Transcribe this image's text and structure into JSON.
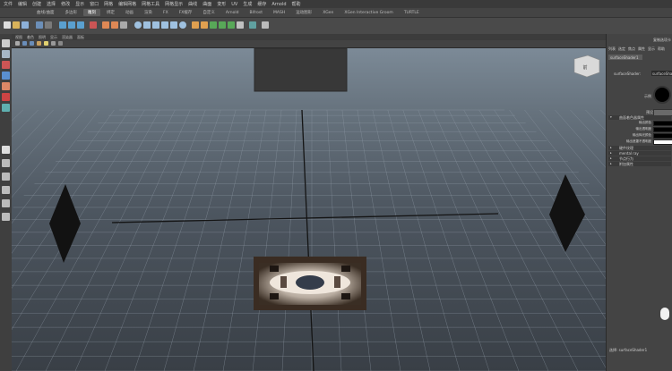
{
  "menubar": {
    "items": [
      "文件",
      "编辑",
      "创建",
      "选择",
      "修改",
      "显示",
      "窗口",
      "网格",
      "编辑网格",
      "网格工具",
      "网格显示",
      "曲线",
      "曲面",
      "变形",
      "UV",
      "生成",
      "缓存",
      "Arnold",
      "帮助"
    ]
  },
  "shelf_tabs": {
    "items": [
      "曲线/曲面",
      "多边形",
      "雕刻",
      "绑定",
      "动画",
      "渲染",
      "FX",
      "FX缓存",
      "自定义",
      "Arnold",
      "Bifrost",
      "MASH",
      "运动图形",
      "XGen",
      "XGen Interactive Groom",
      "TURTLE"
    ],
    "active_index": 2
  },
  "panel_menu": {
    "items": [
      "视图",
      "着色",
      "照明",
      "显示",
      "渲染器",
      "面板"
    ]
  },
  "viewport": {
    "view_cube_label": "前",
    "colors": {
      "sky_top": "#7c8a97",
      "ground": "#393f46",
      "grid": "#8f9aa6",
      "axis": "#1a1a1a",
      "light": "#111111"
    }
  },
  "attribute_editor": {
    "tabs": [
      "列表",
      "选定",
      "焦点",
      "属性",
      "显示",
      "帮助"
    ],
    "node_tab": "surfaceShader1",
    "type_label": "surfaceShader:",
    "type_value": "surfaceShader1",
    "sample_label": "示例",
    "preset_label": "预设",
    "copy_tab_button": "复制选项卡",
    "sections": [
      {
        "label": "曲面着色器属性",
        "expanded": true
      },
      {
        "label": "硬件纹理",
        "expanded": false
      },
      {
        "label": "mental ray",
        "expanded": false
      },
      {
        "label": "节点行为",
        "expanded": false
      },
      {
        "label": "附加属性",
        "expanded": false
      }
    ],
    "attributes": [
      {
        "label": "输出颜色",
        "color": "#000000"
      },
      {
        "label": "输出透明度",
        "color": "#000000"
      },
      {
        "label": "输出辉光颜色",
        "color": "#000000"
      },
      {
        "label": "输出遮罩不透明度",
        "color": "#ffffff"
      }
    ],
    "footer": "选择: surfaceShader1"
  }
}
